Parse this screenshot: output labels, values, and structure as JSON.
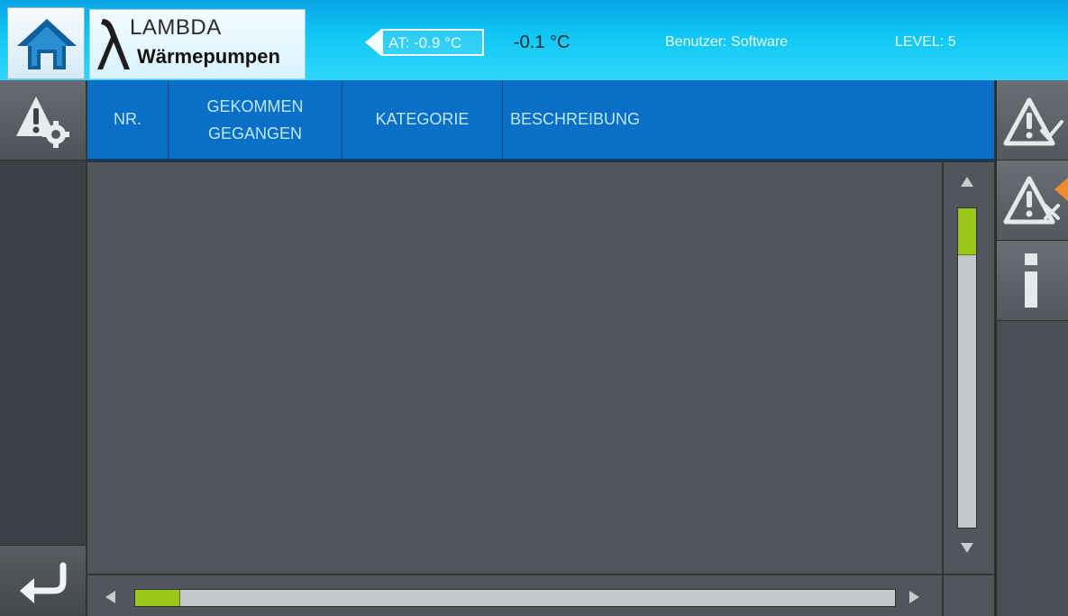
{
  "header": {
    "logo_top": "LAMBDA",
    "logo_bottom": "Wärmepumpen",
    "at_label": "AT: -0.9 °C",
    "temperature": "-0.1 °C",
    "user_label": "Benutzer: Software",
    "level_label": "LEVEL: 5"
  },
  "table": {
    "columns": [
      {
        "label": "NR."
      },
      {
        "label_line1": "GEKOMMEN",
        "label_line2": "GEGANGEN"
      },
      {
        "label": "KATEGORIE"
      },
      {
        "label": "BESCHREIBUNG"
      }
    ],
    "rows": []
  },
  "scroll": {
    "vertical_position": 0.0,
    "horizontal_position": 0.0
  },
  "icons": {
    "home": "home-icon",
    "alarm_settings": "alarm-settings-icon",
    "back": "back-arrow-icon",
    "acknowledge": "alarm-acknowledge-icon",
    "delete": "alarm-delete-icon",
    "info": "info-icon"
  },
  "colors": {
    "header": "#10c7f4",
    "table_header": "#0a6fc6",
    "scroll_thumb": "#9ac81c",
    "accent": "#f08a2c"
  }
}
